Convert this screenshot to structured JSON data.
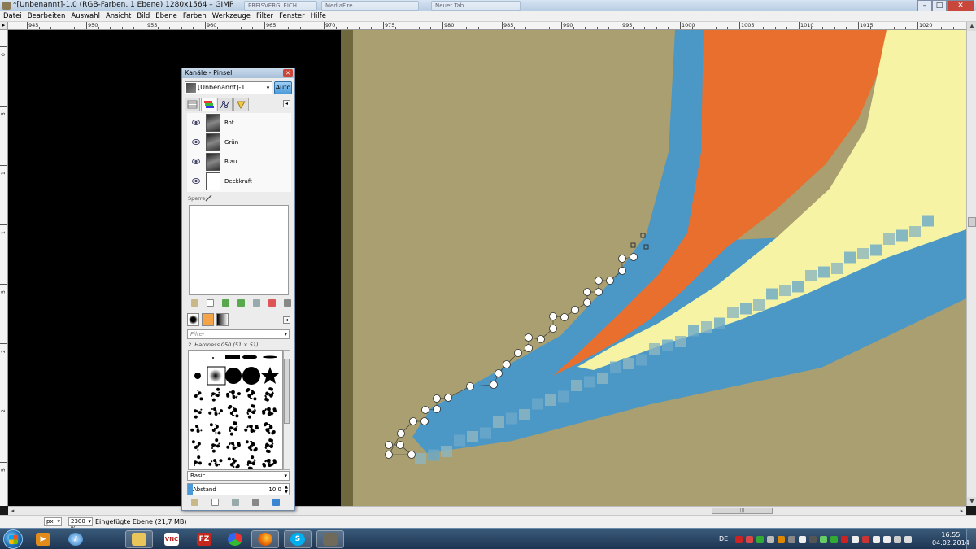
{
  "window": {
    "title": "*[Unbenannt]-1.0 (RGB-Farben, 1 Ebene) 1280x1564 – GIMP",
    "ghost_tabs": [
      "PREISVERGLEICH...",
      "MediaFire",
      "Neuer Tab"
    ]
  },
  "menu": [
    "Datei",
    "Bearbeiten",
    "Auswahl",
    "Ansicht",
    "Bild",
    "Ebene",
    "Farben",
    "Werkzeuge",
    "Filter",
    "Fenster",
    "Hilfe"
  ],
  "ruler": {
    "h_labels": [
      "945",
      "950",
      "955",
      "960",
      "965",
      "970",
      "975",
      "980",
      "985",
      "990",
      "995",
      "1000",
      "1005",
      "1010",
      "1015",
      "1020"
    ],
    "v_labels": [
      "0",
      "5",
      "1",
      "1",
      "5",
      "2",
      "2",
      "5"
    ]
  },
  "canvas": {
    "colors": {
      "background": "#a99f70",
      "blue": "#4b97c5",
      "orange": "#e86f2e",
      "cream": "#f6f4a4",
      "offcanvas": "#000000",
      "edge": "#6f683f"
    },
    "path_handles": "white-circle-handles"
  },
  "dock": {
    "title": "Kanäle - Pinsel",
    "image_name": "[Unbenannt]-1",
    "auto_label": "Auto",
    "tabs": [
      "layers-tab-icon",
      "channels-tab-icon",
      "paths-tab-icon",
      "undo-tab-icon"
    ],
    "channels": [
      {
        "name": "Rot",
        "visible": true
      },
      {
        "name": "Grün",
        "visible": true
      },
      {
        "name": "Blau",
        "visible": true
      },
      {
        "name": "Deckkraft",
        "visible": true
      }
    ],
    "lock_label": "Sperre:",
    "brush_filter_placeholder": "Filter",
    "brush_name": "2. Hardness 050 (51 × 51)",
    "brush_set": "Basic.",
    "spacing_label": "Abstand",
    "spacing_value": "10.0",
    "spacing_fraction": 0.05
  },
  "status": {
    "unit": "px",
    "zoom": "2300 %",
    "message": "Eingefügte Ebene (21,7 MB)"
  },
  "taskbar": {
    "apps": [
      "media-player-icon",
      "itunes-icon",
      "file-explorer-icon",
      "vnc-icon",
      "filezilla-icon",
      "color-app-icon",
      "firefox-icon",
      "skype-icon",
      "gimp-icon"
    ],
    "vnc_label": "VNC",
    "filezilla_label": "FZ",
    "language": "DE",
    "time": "16:55",
    "date": "04.02.2014"
  }
}
